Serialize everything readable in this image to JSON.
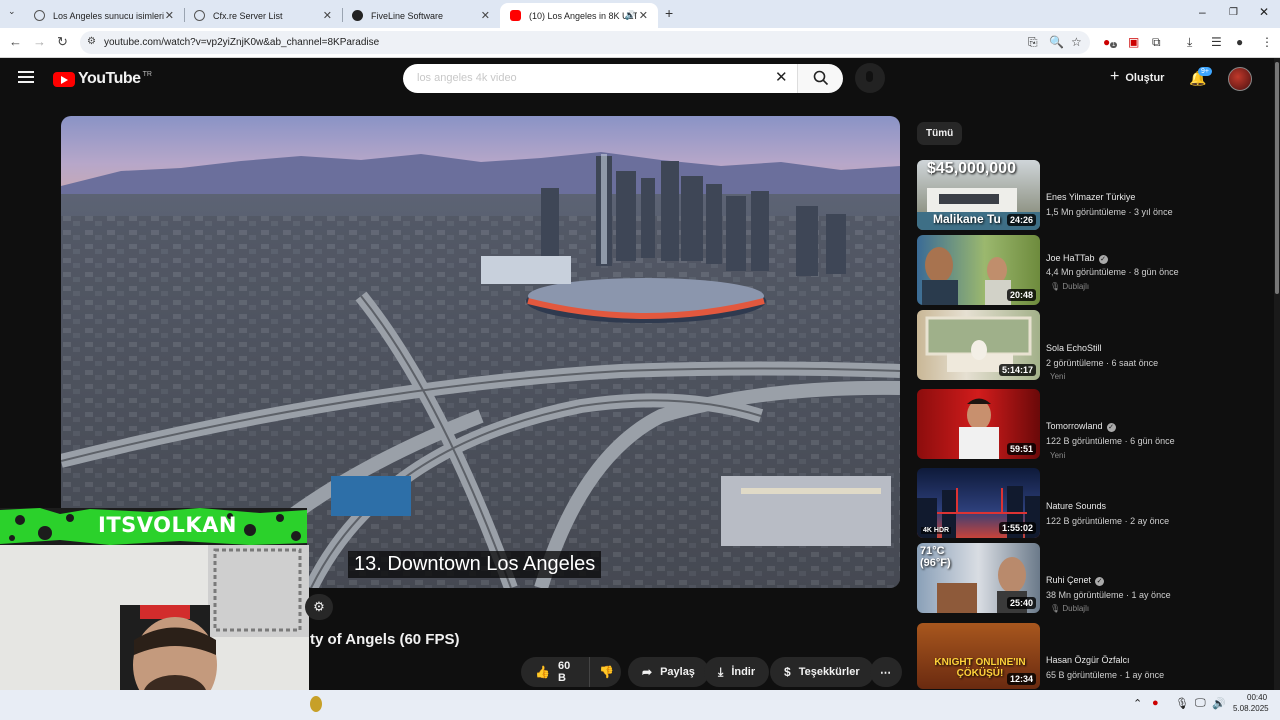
{
  "browser": {
    "tabs": [
      {
        "title": "Los Angeles sunucu isimleri",
        "icon": "globe-icon"
      },
      {
        "title": "Cfx.re Server List",
        "icon": "globe-icon"
      },
      {
        "title": "FiveLine Software",
        "icon": "fiveline-icon"
      },
      {
        "title": "(10) Los Angeles in 8K ULTR",
        "icon": "youtube-icon",
        "active": true
      }
    ],
    "url": "youtube.com/watch?v=vp2yiZnjK0w&ab_channel=8KParadise",
    "extension_badge": "1"
  },
  "youtube": {
    "logo_text": "YouTube",
    "region": "TR",
    "search_value": "los angeles 4k video",
    "create_label": "Oluştur",
    "notifications": "9+"
  },
  "player": {
    "caption": "13. Downtown Los Angeles"
  },
  "video": {
    "title": "ty of Angels (60 FPS)",
    "likes": "60 B",
    "share_label": "Paylaş",
    "download_label": "İndir",
    "thanks_label": "Teşekkürler"
  },
  "overlay": {
    "streamer_name": "ITSVOLKAN"
  },
  "sidebar": {
    "chip": "Tümü",
    "items": [
      {
        "thumb_text": "$45,000,000",
        "thumb_sub": "Malikane Tu",
        "duration": "24:26",
        "channel": "Enes Yilmazer Türkiye",
        "verified": false,
        "views": "1,5 Mn görüntüleme",
        "age": "3 yıl önce",
        "badge": ""
      },
      {
        "thumb_text": "",
        "thumb_sub": "",
        "duration": "20:48",
        "channel": "Joe HaTTab",
        "verified": true,
        "views": "4,4 Mn görüntüleme",
        "age": "8 gün önce",
        "badge": "Dublajlı"
      },
      {
        "thumb_text": "",
        "thumb_sub": "",
        "duration": "5:14:17",
        "channel": "Sola EchoStill",
        "verified": false,
        "views": "2 görüntüleme",
        "age": "6 saat önce",
        "badge": "Yeni"
      },
      {
        "thumb_text": "",
        "thumb_sub": "",
        "duration": "59:51",
        "channel": "Tomorrowland",
        "verified": true,
        "views": "122 B görüntüleme",
        "age": "6 gün önce",
        "badge": "Yeni"
      },
      {
        "thumb_text": "4K HDR",
        "thumb_sub": "",
        "duration": "1:55:02",
        "channel": "Nature Sounds",
        "verified": false,
        "views": "122 B görüntüleme",
        "age": "2 ay önce",
        "badge": ""
      },
      {
        "thumb_text": "71°C (96°F)",
        "thumb_sub": "",
        "duration": "25:40",
        "channel": "Ruhi Çenet",
        "verified": true,
        "views": "38 Mn görüntüleme",
        "age": "1 ay önce",
        "badge": "Dublajlı"
      },
      {
        "thumb_text": "KNIGHT ONLINE'IN ÇÖKÜŞÜ!",
        "thumb_sub": "",
        "duration": "12:34",
        "channel": "Hasan Özgür Özfalcı",
        "verified": false,
        "views": "65 B görüntüleme",
        "age": "1 ay önce",
        "badge": ""
      }
    ]
  },
  "taskbar": {
    "time": "00:40",
    "date": "5.08.2025"
  },
  "colors": {
    "yt_red": "#ff0000",
    "background": "#0f0f0f",
    "button_bg": "#272727",
    "overlay_green": "#2bd12b"
  }
}
